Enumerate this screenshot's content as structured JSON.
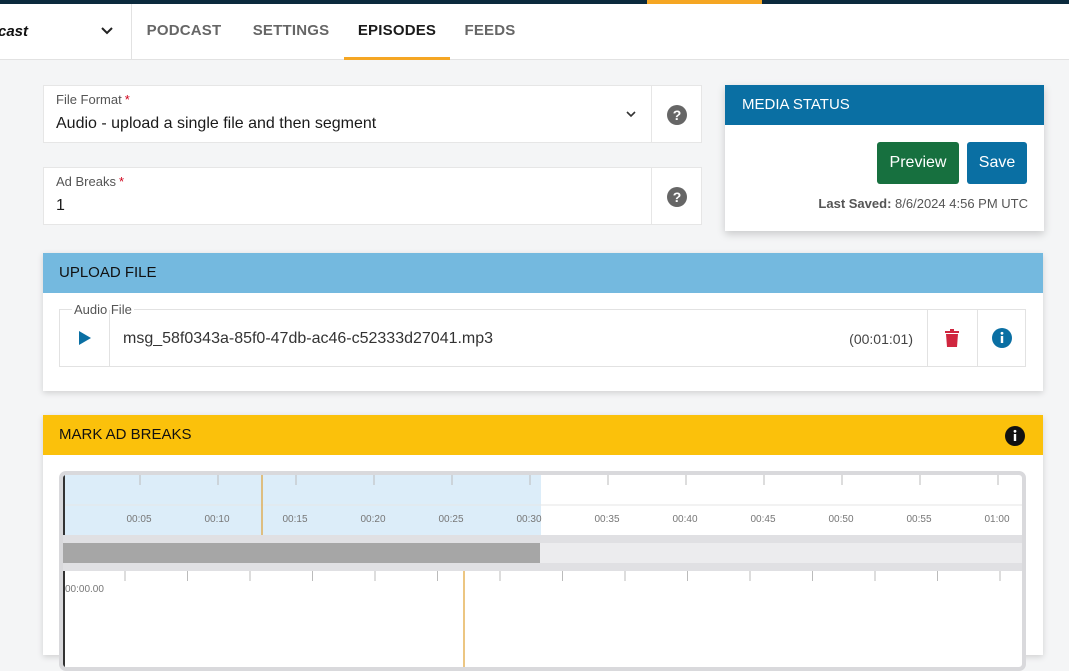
{
  "header": {
    "podcast_name": "cast",
    "tabs": [
      {
        "label": "PODCAST"
      },
      {
        "label": "SETTINGS"
      },
      {
        "label": "EPISODES"
      },
      {
        "label": "FEEDS"
      }
    ],
    "active_tab": "EPISODES"
  },
  "file_format": {
    "label": "File Format",
    "required_mark": "*",
    "value": "Audio - upload a single file and then segment"
  },
  "ad_breaks": {
    "label": "Ad Breaks",
    "required_mark": "*",
    "value": "1"
  },
  "media_status": {
    "title": "MEDIA STATUS",
    "preview_label": "Preview",
    "save_label": "Save",
    "last_saved_label": "Last Saved:",
    "last_saved_value": "8/6/2024 4:56 PM UTC"
  },
  "upload_file": {
    "title": "UPLOAD FILE",
    "field_label": "Audio File",
    "file_name": "msg_58f0343a-85f0-47db-ac46-c52333d27041.mp3",
    "duration": "(00:01:01)"
  },
  "mark_ad_breaks": {
    "title": "MARK AD BREAKS",
    "timeline_labels": [
      "00:05",
      "00:10",
      "00:15",
      "00:20",
      "00:25",
      "00:30",
      "00:35",
      "00:40",
      "00:45",
      "00:50",
      "00:55",
      "01:00"
    ],
    "zoom_start_label": "00:00.00"
  },
  "colors": {
    "accent": "#f5a623",
    "media_status_header": "#0a6fa3",
    "preview_button": "#17703f",
    "upload_header": "#74b9df",
    "ad_breaks_header": "#fbc10b",
    "delete_icon": "#d0263f"
  },
  "icons": {
    "dropdown": "chevron-down-icon",
    "help": "question-circle-icon",
    "play": "play-icon",
    "delete": "trash-icon",
    "info": "info-circle-icon"
  }
}
